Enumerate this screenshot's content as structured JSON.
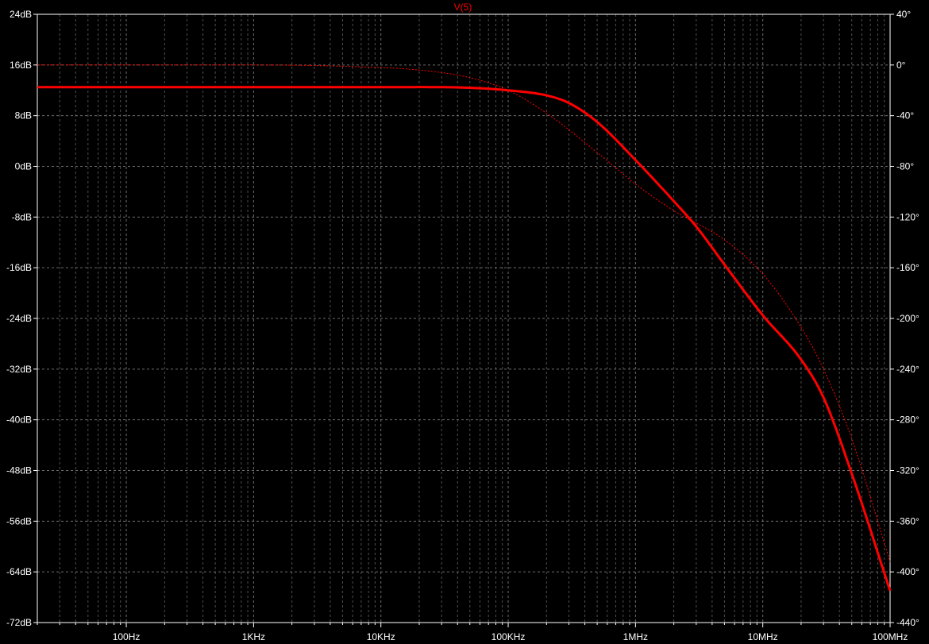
{
  "chart_data": {
    "type": "line",
    "title": "V(5)",
    "x_scale": "log",
    "xlim": [
      20,
      100000000
    ],
    "ylim_left": [
      -72,
      24
    ],
    "ylim_right": [
      -440,
      40
    ],
    "left_ticks": [
      "24dB",
      "16dB",
      "8dB",
      "0dB",
      "-8dB",
      "-16dB",
      "-24dB",
      "-32dB",
      "-40dB",
      "-48dB",
      "-56dB",
      "-64dB",
      "-72dB"
    ],
    "right_ticks": [
      "40°",
      "0°",
      "-40°",
      "-80°",
      "-120°",
      "-160°",
      "-200°",
      "-240°",
      "-280°",
      "-320°",
      "-360°",
      "-400°",
      "-440°"
    ],
    "x_ticks": [
      "100Hz",
      "1KHz",
      "10KHz",
      "100KHz",
      "1MHz",
      "10MHz",
      "100MHz"
    ],
    "grid": true,
    "colors": {
      "background": "#000000",
      "trace": "#ff0000",
      "grid": "#7a7a7a",
      "axis": "#ffffff",
      "title": "#ff0000"
    },
    "series": [
      {
        "style": "solid",
        "axis": "left",
        "x": [
          20,
          1000,
          10000,
          50000,
          100000,
          200000,
          300000,
          500000,
          1000000,
          2000000,
          3000000,
          5000000,
          10000000,
          20000000,
          30000000,
          50000000,
          100000000
        ],
        "y": [
          12.5,
          12.5,
          12.5,
          12.4,
          12.0,
          11.2,
          10.0,
          7.0,
          1.0,
          -5.5,
          -9.5,
          -15.5,
          -23.5,
          -30.5,
          -36.5,
          -48.5,
          -67.0
        ]
      },
      {
        "style": "dotted",
        "axis": "right",
        "x": [
          20,
          1000,
          5000,
          20000,
          50000,
          100000,
          200000,
          500000,
          1000000,
          2000000,
          5000000,
          10000000,
          20000000,
          30000000,
          50000000,
          100000000
        ],
        "y": [
          0,
          0,
          -1,
          -4,
          -10,
          -20,
          -38,
          -69,
          -94,
          -115,
          -138,
          -165,
          -207,
          -240,
          -295,
          -392
        ]
      }
    ]
  }
}
